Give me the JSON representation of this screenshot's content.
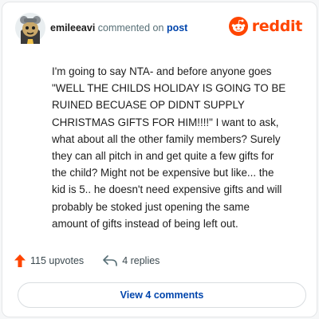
{
  "header": {
    "username": "emileeavi",
    "action_text": "commented on",
    "target_link": "post"
  },
  "brand": {
    "wordmark": "reddit",
    "icon": "reddit-alien-icon",
    "color": "#ff4500"
  },
  "comment": {
    "lines": [
      "I'm going to say NTA- and before anyone goes",
      "\"WELL THE CHILDS HOLIDAY IS GOING TO BE",
      "RUINED BECUASE OP DIDNT SUPPLY",
      "CHRISTMAS GIFTS FOR HIM!!!!\" I want to ask,",
      "what about all the other family members? Surely",
      "they can all pitch in and get quite a few gifts for",
      "the child? Might not be expensive but like... the",
      "kid is 5.. he doesn't need expensive gifts and will",
      "probably be stoked just opening the same",
      "amount of gifts instead of being left out."
    ]
  },
  "actions": {
    "upvotes_label": "115 upvotes",
    "replies_label": "4 replies",
    "upvote_icon": "upvote-arrow-icon",
    "reply_icon": "reply-icon",
    "upvote_color": "#ff4500"
  },
  "footer": {
    "view_comments_label": "View 4 comments"
  },
  "colors": {
    "link": "#0045ac",
    "text": "#1c1c1c",
    "muted": "#576f76"
  }
}
